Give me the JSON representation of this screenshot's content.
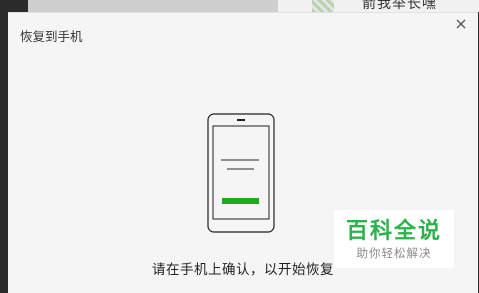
{
  "background": {
    "partial_text": "箭我举长嘿"
  },
  "dialog": {
    "title": "恢复到手机",
    "close_symbol": "×",
    "message": "请在手机上确认，以开始恢复",
    "accent_color": "#1aad19"
  },
  "watermark": {
    "title": "百科全说",
    "subtitle": "助你轻松解决",
    "color": "#2ab34a"
  }
}
